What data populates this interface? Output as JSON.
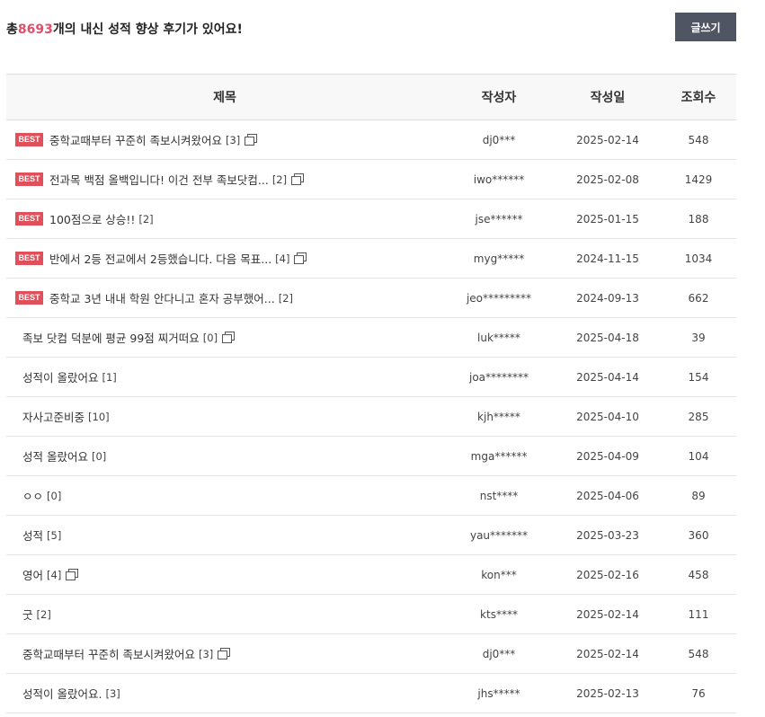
{
  "header": {
    "summary_prefix": "총",
    "summary_count": "8693",
    "summary_suffix": "개의 내신 성적 향상 후기가 있어요!",
    "write_button": "글쓰기"
  },
  "columns": {
    "title": "제목",
    "author": "작성자",
    "date": "작성일",
    "views": "조회수"
  },
  "best_label": "BEST",
  "posts": [
    {
      "best": true,
      "title": "중학교때부터 꾸준히 족보시켜왔어요",
      "comments": "[3]",
      "has_image": true,
      "author": "dj0***",
      "date": "2025-02-14",
      "views": "548"
    },
    {
      "best": true,
      "title": "전과목 백점 올백입니다! 이건 전부 족보닷컴...",
      "comments": "[2]",
      "has_image": true,
      "author": "iwo******",
      "date": "2025-02-08",
      "views": "1429"
    },
    {
      "best": true,
      "title": "100점으로 상승!!",
      "comments": "[2]",
      "has_image": false,
      "author": "jse******",
      "date": "2025-01-15",
      "views": "188"
    },
    {
      "best": true,
      "title": "반에서 2등 전교에서 2등했습니다. 다음 목표...",
      "comments": "[4]",
      "has_image": true,
      "author": "myg*****",
      "date": "2024-11-15",
      "views": "1034"
    },
    {
      "best": true,
      "title": "중학교 3년 내내 학원 안다니고 혼자 공부했어...",
      "comments": "[2]",
      "has_image": false,
      "author": "jeo*********",
      "date": "2024-09-13",
      "views": "662"
    },
    {
      "best": false,
      "title": "족보 닷컴 덕분에 평균 99점 찌거떠요",
      "comments": "[0]",
      "has_image": true,
      "author": "luk*****",
      "date": "2025-04-18",
      "views": "39"
    },
    {
      "best": false,
      "title": "성적이 올랐어요",
      "comments": "[1]",
      "has_image": false,
      "author": "joa********",
      "date": "2025-04-14",
      "views": "154"
    },
    {
      "best": false,
      "title": "자사고준비중",
      "comments": "[10]",
      "has_image": false,
      "author": "kjh*****",
      "date": "2025-04-10",
      "views": "285"
    },
    {
      "best": false,
      "title": "성적 올랐어요",
      "comments": "[0]",
      "has_image": false,
      "author": "mga******",
      "date": "2025-04-09",
      "views": "104"
    },
    {
      "best": false,
      "title": "ㅇㅇ",
      "comments": "[0]",
      "has_image": false,
      "author": "nst****",
      "date": "2025-04-06",
      "views": "89"
    },
    {
      "best": false,
      "title": "성적",
      "comments": "[5]",
      "has_image": false,
      "author": "yau*******",
      "date": "2025-03-23",
      "views": "360"
    },
    {
      "best": false,
      "title": "영어",
      "comments": "[4]",
      "has_image": true,
      "author": "kon***",
      "date": "2025-02-16",
      "views": "458"
    },
    {
      "best": false,
      "title": "굿",
      "comments": "[2]",
      "has_image": false,
      "author": "kts****",
      "date": "2025-02-14",
      "views": "111"
    },
    {
      "best": false,
      "title": "중학교때부터 꾸준히 족보시켜왔어요",
      "comments": "[3]",
      "has_image": true,
      "author": "dj0***",
      "date": "2025-02-14",
      "views": "548"
    },
    {
      "best": false,
      "title": "성적이 올랐어요.",
      "comments": "[3]",
      "has_image": false,
      "author": "jhs*****",
      "date": "2025-02-13",
      "views": "76"
    }
  ]
}
